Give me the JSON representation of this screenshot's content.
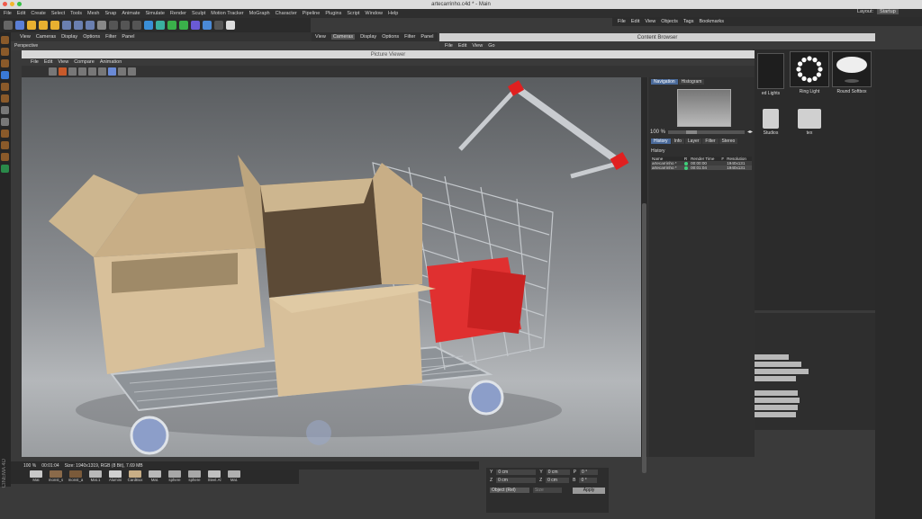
{
  "window": {
    "title": "artecarrinho.c4d * - Main"
  },
  "main_menu": [
    "File",
    "Edit",
    "Create",
    "Select",
    "Tools",
    "Mesh",
    "Snap",
    "Animate",
    "Simulate",
    "Render",
    "Sculpt",
    "Motion Tracker",
    "MoGraph",
    "Character",
    "Pipeline",
    "Plugins",
    "Script",
    "Window",
    "Help"
  ],
  "layout": {
    "label": "Layout:",
    "value": "Startup"
  },
  "viewport_menu": [
    "View",
    "Cameras",
    "Display",
    "Options",
    "Filter",
    "Panel"
  ],
  "viewport_label": "Perspective",
  "camera_menu": {
    "items": [
      "View",
      "Cameras",
      "Display",
      "Options",
      "Filter",
      "Panel"
    ],
    "selected": "Cameras"
  },
  "right_top_menu": [
    "File",
    "Edit",
    "View",
    "Objects",
    "Tags",
    "Bookmarks"
  ],
  "content_browser": {
    "title": "Content Browser",
    "menu": [
      "File",
      "Edit",
      "View",
      "Go"
    ],
    "items": [
      {
        "label": "ed Lights",
        "kind": "thumb"
      },
      {
        "label": "Ring Light",
        "kind": "thumb"
      },
      {
        "label": "Round Softbox",
        "kind": "thumb"
      },
      {
        "label": "Studios",
        "kind": "folder"
      },
      {
        "label": "tex",
        "kind": "folder"
      }
    ]
  },
  "picture_viewer": {
    "title": "Picture Viewer",
    "menu": [
      "File",
      "Edit",
      "View",
      "Compare",
      "Animation"
    ],
    "nav_tabs": [
      "Navigation",
      "Histogram"
    ],
    "zoom": "100 %",
    "history_tabs": [
      "History",
      "Info",
      "Layer",
      "Filter",
      "Stereo"
    ],
    "history_label": "History",
    "history_columns": [
      "Name",
      "R",
      "Render Time",
      "F",
      "Resolution"
    ],
    "history_rows": [
      {
        "name": "artecarrinho *",
        "time": "00:00:00",
        "res": "1940x131"
      },
      {
        "name": "artecarrinho *",
        "time": "00:01:04",
        "res": "1940x131"
      }
    ],
    "status_zoom": "100 %",
    "status_time": "00:01:04",
    "status_info": "Size: 1940x1319, RGB (8 Bit), 7.69 MB"
  },
  "materials": [
    "Mat",
    "monst_s",
    "monst_a",
    "Mat.1",
    "Alumini",
    "CardBox",
    "Mat.",
    "sphere",
    "sphere",
    "Steel.Al",
    "Mat."
  ],
  "coordinates": {
    "rows": [
      {
        "axis1": "Y",
        "v1": "0 cm",
        "axis2": "Y",
        "v2": "0 cm",
        "axis3": "P",
        "v3": "0 °"
      },
      {
        "axis1": "Z",
        "v1": "0 cm",
        "axis2": "Z",
        "v2": "0 cm",
        "axis3": "B",
        "v3": "0 °"
      }
    ],
    "mode": "Object (Rel)",
    "size_mode": "Size",
    "apply": "Apply"
  },
  "logo": "CINEMA 4D",
  "colors": {
    "accent_red": "#d83020",
    "render_box": "#d8c09a",
    "basket_red": "#e03030",
    "tab_selected": "#4a6a9a"
  }
}
